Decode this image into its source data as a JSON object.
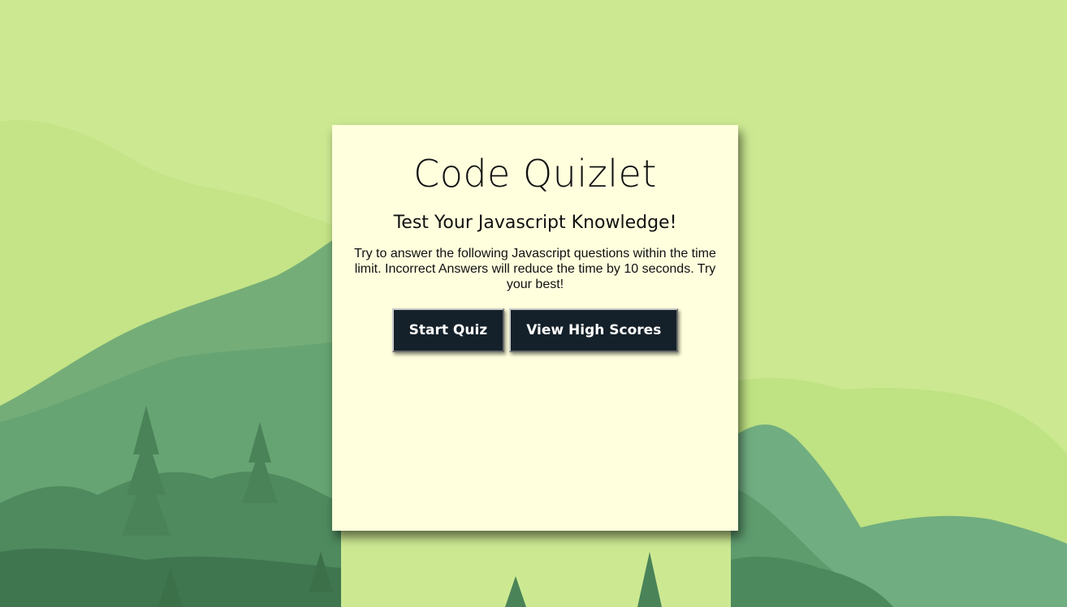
{
  "page": {
    "background_color": "#cce992",
    "card_color": "#ffffde",
    "button_color": "#15212a"
  },
  "quiz": {
    "title": "Code Quizlet",
    "subtitle": "Test Your Javascript Knowledge!",
    "description": "Try to answer the following Javascript questions within the time limit. Incorrect Answers will reduce the time by 10 seconds. Try your best!",
    "start_label": "Start Quiz",
    "high_scores_label": "View High Scores"
  }
}
